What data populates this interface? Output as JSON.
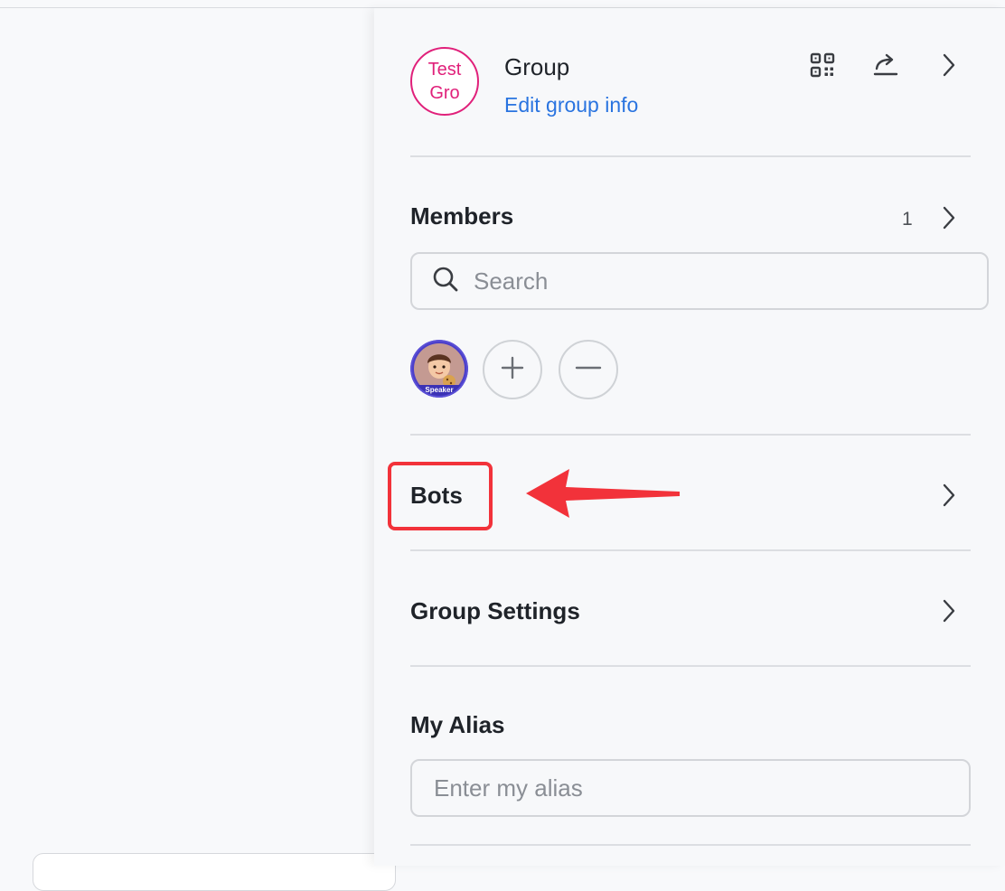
{
  "group": {
    "avatar_text_line1": "Test",
    "avatar_text_line2": "Gro",
    "name": "Group",
    "edit_link": "Edit group info"
  },
  "header_icons": [
    "qr-code-icon",
    "share-icon",
    "chevron-right-icon"
  ],
  "members": {
    "title": "Members",
    "count": "1",
    "search_placeholder": "Search",
    "avatar_caption": "Speaker",
    "add_icon": "plus-icon",
    "remove_icon": "minus-icon"
  },
  "bots": {
    "title": "Bots"
  },
  "group_settings": {
    "title": "Group Settings"
  },
  "my_alias": {
    "title": "My Alias",
    "placeholder": "Enter my alias"
  },
  "annotation": {
    "highlight_color": "#f2323a",
    "arrow_color": "#f2323a"
  },
  "colors": {
    "accent_link": "#2a74e0",
    "avatar_pink": "#e0207a"
  }
}
